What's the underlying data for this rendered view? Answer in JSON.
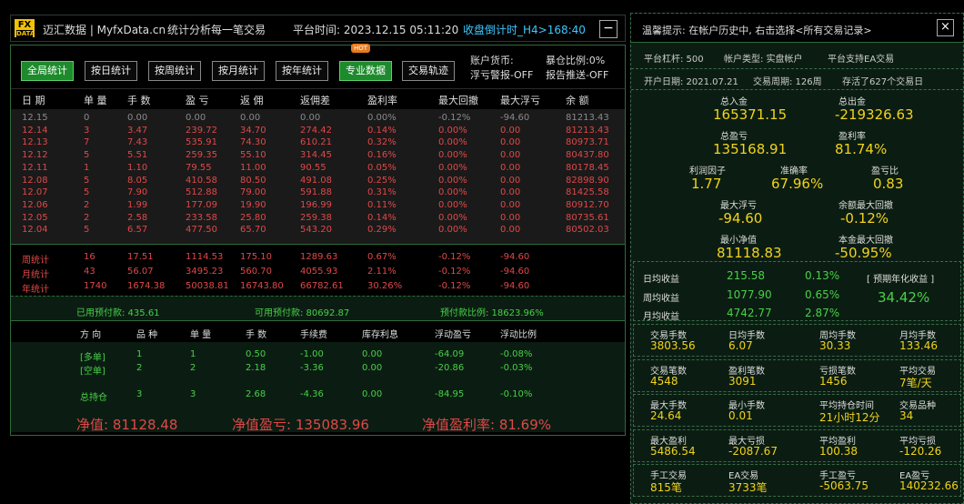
{
  "title": {
    "logo_top": "FX",
    "logo_bottom": "DATA",
    "app_name": "迈汇数据 | MyfxData.cn",
    "slogan": "统计分析每一笔交易",
    "platform_time": "平台时间: 2023.12.15 05:11:20",
    "countdown": "收盘倒计时_H4>168:40",
    "close_label": "−"
  },
  "toolbar": {
    "buttons": [
      "全局统计",
      "按日统计",
      "按周统计",
      "按月统计",
      "按年统计",
      "专业数据",
      "交易轨迹"
    ],
    "hot_badge": "HOT",
    "currency": "账户货币:",
    "float_alert": "浮亏警报-OFF",
    "exposure": "暴仓比例:0%",
    "report_push": "报告推送-OFF"
  },
  "daily_table": {
    "headers": [
      "日 期",
      "单 量",
      "手 数",
      "盈 亏",
      "返 佣",
      "返佣差",
      "盈利率",
      "最大回撤",
      "最大浮亏",
      "余 额"
    ],
    "rows": [
      [
        "12.15",
        "0",
        "0.00",
        "0.00",
        "0.00",
        "0.00",
        "0.00%",
        "-0.12%",
        "-94.60",
        "81213.43"
      ],
      [
        "12.14",
        "3",
        "3.47",
        "239.72",
        "34.70",
        "274.42",
        "0.14%",
        "0.00%",
        "0.00",
        "81213.43"
      ],
      [
        "12.13",
        "7",
        "7.43",
        "535.91",
        "74.30",
        "610.21",
        "0.32%",
        "0.00%",
        "0.00",
        "80973.71"
      ],
      [
        "12.12",
        "5",
        "5.51",
        "259.35",
        "55.10",
        "314.45",
        "0.16%",
        "0.00%",
        "0.00",
        "80437.80"
      ],
      [
        "12.11",
        "1",
        "1.10",
        "79.55",
        "11.00",
        "90.55",
        "0.05%",
        "0.00%",
        "0.00",
        "80178.45"
      ],
      [
        "12.08",
        "5",
        "8.05",
        "410.58",
        "80.50",
        "491.08",
        "0.25%",
        "0.00%",
        "0.00",
        "82898.90"
      ],
      [
        "12.07",
        "5",
        "7.90",
        "512.88",
        "79.00",
        "591.88",
        "0.31%",
        "0.00%",
        "0.00",
        "81425.58"
      ],
      [
        "12.06",
        "2",
        "1.99",
        "177.09",
        "19.90",
        "196.99",
        "0.11%",
        "0.00%",
        "0.00",
        "80912.70"
      ],
      [
        "12.05",
        "2",
        "2.58",
        "233.58",
        "25.80",
        "259.38",
        "0.14%",
        "0.00%",
        "0.00",
        "80735.61"
      ],
      [
        "12.04",
        "5",
        "6.57",
        "477.50",
        "65.70",
        "543.20",
        "0.29%",
        "0.00%",
        "0.00",
        "80502.03"
      ]
    ]
  },
  "summary": [
    [
      "周统计",
      "16",
      "17.51",
      "1114.53",
      "175.10",
      "1289.63",
      "0.67%",
      "-0.12%",
      "-94.60"
    ],
    [
      "月统计",
      "43",
      "56.07",
      "3495.23",
      "560.70",
      "4055.93",
      "2.11%",
      "-0.12%",
      "-94.60"
    ],
    [
      "年统计",
      "1740",
      "1674.38",
      "50038.81",
      "16743.80",
      "66782.61",
      "30.26%",
      "-0.12%",
      "-94.60"
    ]
  ],
  "prepay": {
    "used": "已用预付款: 435.61",
    "free": "可用预付款: 80692.87",
    "ratio": "预付款比例: 18623.96%"
  },
  "positions": {
    "headers": [
      "方 向",
      "品 种",
      "单 量",
      "手 数",
      "手续费",
      "库存利息",
      "浮动盈亏",
      "浮动比例"
    ],
    "rows": [
      [
        "[多单]",
        "1",
        "1",
        "0.50",
        "-1.00",
        "0.00",
        "-64.09",
        "-0.08%"
      ],
      [
        "[空单]",
        "2",
        "2",
        "2.18",
        "-3.36",
        "0.00",
        "-20.86",
        "-0.03%"
      ]
    ],
    "total": [
      "总持仓",
      "3",
      "3",
      "2.68",
      "-4.36",
      "0.00",
      "-84.95",
      "-0.10%"
    ]
  },
  "equity": {
    "net": "净值: 81128.48",
    "net_pl": "净值盈亏: 135083.96",
    "net_rate": "净值盈利率: 81.69%"
  },
  "right": {
    "hint": "温馨提示: 在帐户历史中, 右击选择<所有交易记录>",
    "close_label": "×",
    "leverage": "平台杠杆: 500",
    "account_type": "帐户类型: 实盘帐户",
    "ea_support": "平台支持EA交易",
    "open_date": "开户日期: 2021.07.21",
    "period": "交易周期: 126周",
    "stored": "存活了627个交易日",
    "deposit_label": "总入金",
    "deposit": "165371.15",
    "withdraw_label": "总出金",
    "withdraw": "-219326.63",
    "profit_label": "总盈亏",
    "profit": "135168.91",
    "profit_rate_label": "盈利率",
    "profit_rate": "81.74%",
    "pf_label": "利润因子",
    "pf": "1.77",
    "accuracy_label": "准确率",
    "accuracy": "67.96%",
    "pl_ratio_label": "盈亏比",
    "pl_ratio": "0.83",
    "max_float_label": "最大浮亏",
    "max_float": "-94.60",
    "max_dd_label": "余额最大回撤",
    "max_dd": "-0.12%",
    "min_equity_label": "最小净值",
    "min_equity": "81118.83",
    "principal_dd_label": "本金最大回撤",
    "principal_dd": "-50.95%",
    "daily_label": "日均收益",
    "daily": "215.58",
    "daily_pct": "0.13%",
    "weekly_label": "周均收益",
    "weekly": "1077.90",
    "weekly_pct": "0.65%",
    "monthly_label": "月均收益",
    "monthly": "4742.77",
    "monthly_pct": "2.87%",
    "annual_label": "[ 预期年化收益 ]",
    "annual": "34.42%",
    "stats": [
      [
        [
          "交易手数",
          "3803.56"
        ],
        [
          "日均手数",
          "6.07"
        ],
        [
          "周均手数",
          "30.33"
        ],
        [
          "月均手数",
          "133.46"
        ]
      ],
      [
        [
          "交易笔数",
          "4548"
        ],
        [
          "盈利笔数",
          "3091"
        ],
        [
          "亏损笔数",
          "1456"
        ],
        [
          "平均交易",
          "7笔/天"
        ]
      ],
      [
        [
          "最大手数",
          "24.64"
        ],
        [
          "最小手数",
          "0.01"
        ],
        [
          "平均持仓时间",
          "21小时12分"
        ],
        [
          "交易品种",
          "34"
        ]
      ],
      [
        [
          "最大盈利",
          "5486.54"
        ],
        [
          "最大亏损",
          "-2087.67"
        ],
        [
          "平均盈利",
          "100.38"
        ],
        [
          "平均亏损",
          "-120.26"
        ]
      ],
      [
        [
          "手工交易",
          "815笔"
        ],
        [
          "EA交易",
          "3733笔"
        ],
        [
          "手工盈亏",
          "-5063.75"
        ],
        [
          "EA盈亏",
          "140232.66"
        ]
      ]
    ]
  }
}
